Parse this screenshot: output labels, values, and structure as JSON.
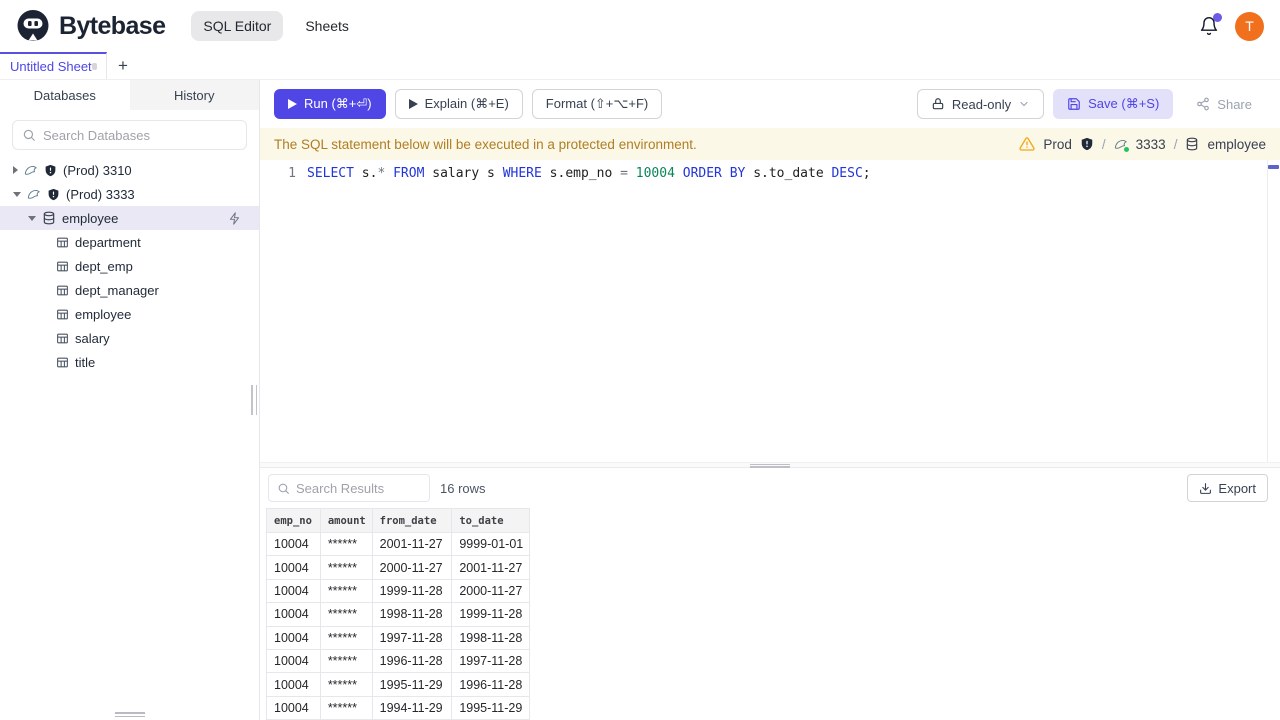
{
  "colors": {
    "accent": "#4f46e5",
    "brand_dark": "#1c2434",
    "avatar_orange": "#f0701e",
    "banner_bg": "#fcf8e8",
    "banner_text": "#b07d22",
    "sql_keyword": "#2235d8",
    "sql_number": "#098658",
    "instance_status_green": "#22c55e",
    "warning_yellow": "#f0a818"
  },
  "header": {
    "brand": "Bytebase",
    "nav_sql_editor": "SQL Editor",
    "nav_sheets": "Sheets",
    "avatar_initial": "T"
  },
  "tabbar": {
    "sheet_title": "Untitled Sheet",
    "new_tab": "+"
  },
  "sidebar": {
    "tab_databases": "Databases",
    "tab_history": "History",
    "search_placeholder": "Search Databases",
    "instances": [
      {
        "label": "(Prod) 3310"
      },
      {
        "label": "(Prod) 3333"
      }
    ],
    "database": "employee",
    "tables": [
      "department",
      "dept_emp",
      "dept_manager",
      "employee",
      "salary",
      "title"
    ]
  },
  "toolbar": {
    "run": "Run (⌘+⏎)",
    "explain": "Explain (⌘+E)",
    "format": "Format (⇧+⌥+F)",
    "readonly": "Read-only",
    "save": "Save (⌘+S)",
    "share": "Share"
  },
  "banner": {
    "message": "The SQL statement below will be executed in a protected environment.",
    "environment": "Prod",
    "separator": "/",
    "instance": "3333",
    "database": "employee"
  },
  "editor": {
    "line_number": "1",
    "tokens": [
      {
        "text": "SELECT",
        "type": "kw"
      },
      {
        "text": " s.",
        "type": "id"
      },
      {
        "text": "*",
        "type": "op"
      },
      {
        "text": " ",
        "type": "id"
      },
      {
        "text": "FROM",
        "type": "kw"
      },
      {
        "text": " salary s ",
        "type": "id"
      },
      {
        "text": "WHERE",
        "type": "kw"
      },
      {
        "text": " s.emp_no ",
        "type": "id"
      },
      {
        "text": "=",
        "type": "op"
      },
      {
        "text": " ",
        "type": "id"
      },
      {
        "text": "10004",
        "type": "num"
      },
      {
        "text": " ",
        "type": "id"
      },
      {
        "text": "ORDER BY",
        "type": "kw"
      },
      {
        "text": " s.to_date ",
        "type": "id"
      },
      {
        "text": "DESC",
        "type": "kw"
      },
      {
        "text": ";",
        "type": "id"
      }
    ]
  },
  "results": {
    "search_placeholder": "Search Results",
    "row_count": "16 rows",
    "export": "Export",
    "columns": [
      "emp_no",
      "amount",
      "from_date",
      "to_date"
    ],
    "rows": [
      [
        "10004",
        "******",
        "2001-11-27",
        "9999-01-01"
      ],
      [
        "10004",
        "******",
        "2000-11-27",
        "2001-11-27"
      ],
      [
        "10004",
        "******",
        "1999-11-28",
        "2000-11-27"
      ],
      [
        "10004",
        "******",
        "1998-11-28",
        "1999-11-28"
      ],
      [
        "10004",
        "******",
        "1997-11-28",
        "1998-11-28"
      ],
      [
        "10004",
        "******",
        "1996-11-28",
        "1997-11-28"
      ],
      [
        "10004",
        "******",
        "1995-11-29",
        "1996-11-28"
      ],
      [
        "10004",
        "******",
        "1994-11-29",
        "1995-11-29"
      ]
    ]
  }
}
